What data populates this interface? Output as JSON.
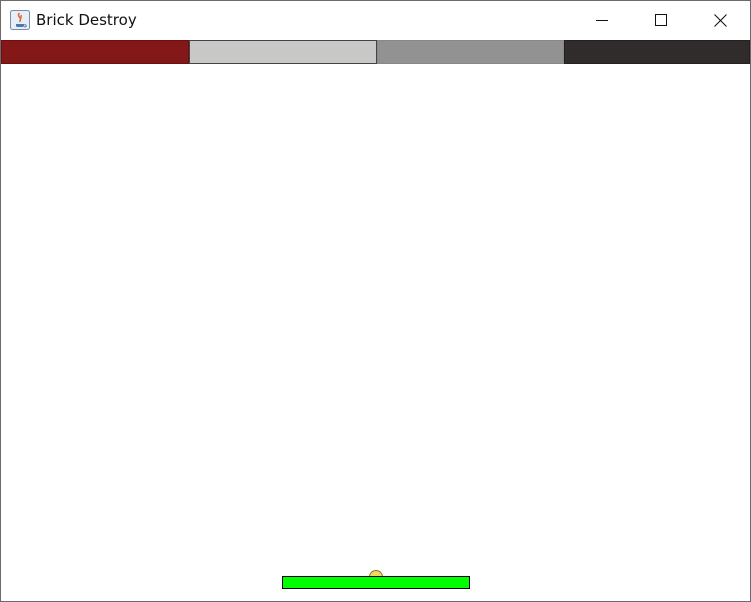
{
  "window": {
    "title": "Brick Destroy",
    "icon": "java-app-icon",
    "controls": [
      "minimize-icon",
      "maximize-icon",
      "close-icon"
    ]
  },
  "game": {
    "bricks": [
      {
        "type": "clay",
        "color": "#841818",
        "border": "#6b1010"
      },
      {
        "type": "cement",
        "color": "#c8c8c6",
        "border": "#444444"
      },
      {
        "type": "steel",
        "color": "#929292",
        "border": "#888888"
      },
      {
        "type": "reinforced",
        "color": "#302c2c",
        "border": "#222222"
      }
    ],
    "paddle": {
      "color": "#00ff00"
    },
    "ball": {
      "color": "#f5d563"
    }
  }
}
